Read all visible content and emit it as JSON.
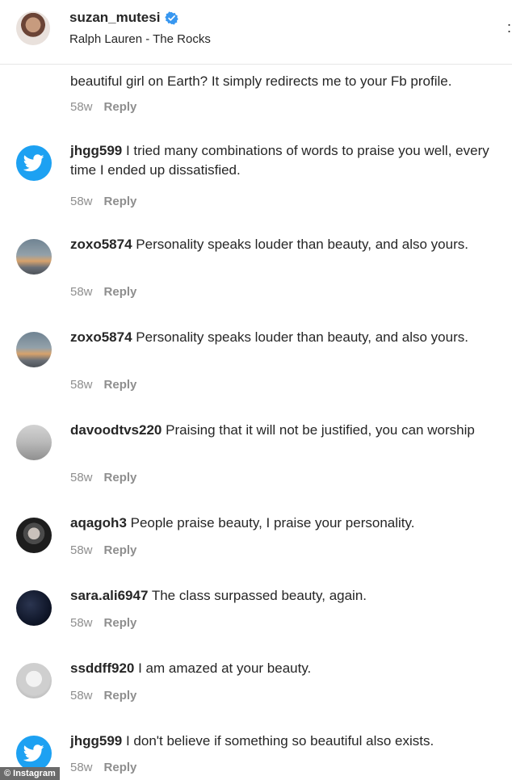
{
  "header": {
    "username": "suzan_mutesi",
    "location": "Ralph Lauren - The Rocks",
    "more_label": ":"
  },
  "comments": [
    {
      "user": "",
      "text": "beautiful girl on Earth? It simply redirects me to your Fb profile.",
      "time": "58w",
      "reply": "Reply",
      "avatar": "partial-avatar"
    },
    {
      "user": "jhgg599",
      "text": " I tried many combinations of words to praise you well, every time I ended up dissatisfied.",
      "time": "58w",
      "reply": "Reply",
      "avatar": "twitter-avatar"
    },
    {
      "user": "zoxo5874",
      "text": " Personality speaks louder than beauty, and also yours.",
      "time": "58w",
      "reply": "Reply",
      "avatar": "sunset-avatar"
    },
    {
      "user": "zoxo5874",
      "text": " Personality speaks louder than beauty, and also yours.",
      "time": "58w",
      "reply": "Reply",
      "avatar": "sunset-avatar"
    },
    {
      "user": "davoodtvs220",
      "text": " Praising that it will not be justified, you can worship",
      "time": "58w",
      "reply": "Reply",
      "avatar": "grey-avatar"
    },
    {
      "user": "aqagoh3",
      "text": " People praise beauty, I praise your personality.",
      "time": "58w",
      "reply": "Reply",
      "avatar": "man-avatar"
    },
    {
      "user": "sara.ali6947",
      "text": " The class surpassed beauty, again.",
      "time": "58w",
      "reply": "Reply",
      "avatar": "space-avatar"
    },
    {
      "user": "ssddff920",
      "text": " I am amazed at your beauty.",
      "time": "58w",
      "reply": "Reply",
      "avatar": "white-avatar"
    },
    {
      "user": "jhgg599",
      "text": " I don't believe if something so beautiful also exists.",
      "time": "58w",
      "reply": "Reply",
      "avatar": "twitter-avatar"
    }
  ],
  "watermark": "© Instagram",
  "colors": {
    "verified": "#3897f0",
    "twitter": "#1da1f2",
    "meta": "#8e8e8e"
  }
}
